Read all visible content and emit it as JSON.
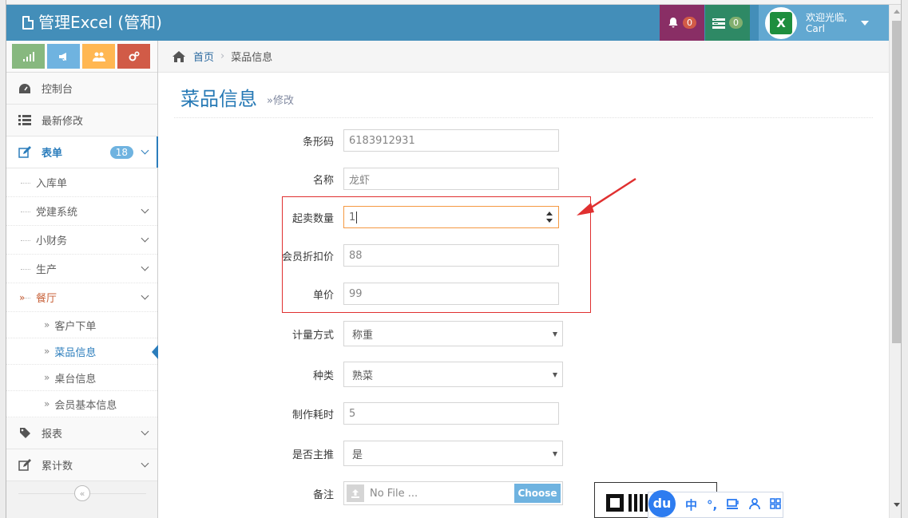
{
  "navbar": {
    "brand": "管理Excel (管和)",
    "notifications_count": "0",
    "tasks_count": "0",
    "user_greeting": "欢迎光临,",
    "user_name": "Carl",
    "avatar_letter": "X"
  },
  "sidebar": {
    "items": [
      {
        "label": "控制台"
      },
      {
        "label": "最新修改"
      },
      {
        "label": "表单",
        "badge": "18"
      },
      {
        "label": "报表"
      },
      {
        "label": "累计数"
      }
    ],
    "form_sub": [
      {
        "label": "入库单"
      },
      {
        "label": "党建系统"
      },
      {
        "label": "小财务"
      },
      {
        "label": "生产"
      },
      {
        "label": "餐厅"
      }
    ],
    "restaurant_sub": [
      {
        "label": "客户下单"
      },
      {
        "label": "菜品信息"
      },
      {
        "label": "桌台信息"
      },
      {
        "label": "会员基本信息"
      }
    ],
    "collapse_glyph": "«"
  },
  "breadcrumb": {
    "home": "首页",
    "current": "菜品信息"
  },
  "page": {
    "title": "菜品信息",
    "subtitle": "»修改"
  },
  "form": {
    "barcode": {
      "label": "条形码",
      "value": "6183912931"
    },
    "name": {
      "label": "名称",
      "value": "龙虾"
    },
    "min_qty": {
      "label": "起卖数量",
      "value": "1"
    },
    "member_price": {
      "label": "会员折扣价",
      "value": "88"
    },
    "unit_price": {
      "label": "单价",
      "value": "99"
    },
    "measure": {
      "label": "计量方式",
      "value": "称重"
    },
    "category": {
      "label": "种类",
      "value": "熟菜"
    },
    "prep_time": {
      "label": "制作耗时",
      "value": "5"
    },
    "featured": {
      "label": "是否主推",
      "value": "是"
    },
    "note": {
      "label": "备注",
      "placeholder": "No File ...",
      "button": "Choose"
    }
  },
  "ime": {
    "logo": "du",
    "lang": "中",
    "punct": "°,"
  },
  "colors": {
    "navbar": "#438eb9",
    "accent": "#2b7dbc",
    "highlight": "#e03030"
  }
}
